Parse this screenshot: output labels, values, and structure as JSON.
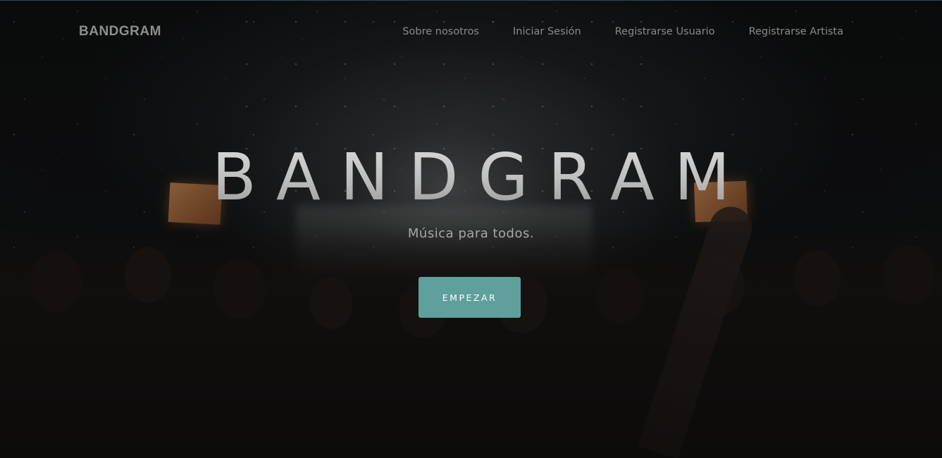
{
  "nav": {
    "brand": "BANDGRAM",
    "links": [
      {
        "label": "Sobre nosotros"
      },
      {
        "label": "Iniciar Sesión"
      },
      {
        "label": "Registrarse Usuario"
      },
      {
        "label": "Registrarse Artista"
      }
    ]
  },
  "hero": {
    "title": "BANDGRAM",
    "subtitle": "Música para todos.",
    "cta_label": "EMPEZAR"
  },
  "colors": {
    "accent": "#5f9f9c",
    "nav_text": "#8a8a8a",
    "title_text": "#cfcfcf"
  }
}
